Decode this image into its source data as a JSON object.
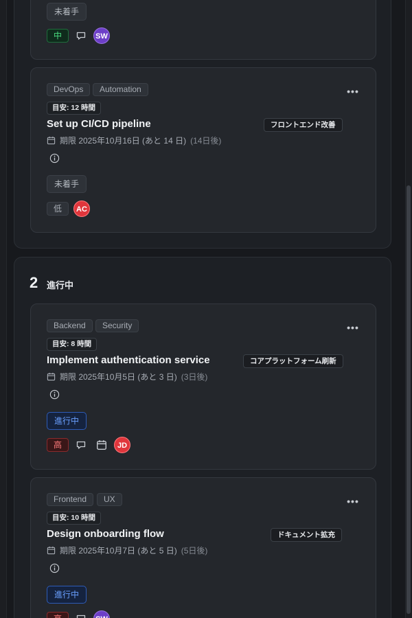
{
  "top_card": {
    "status": "未着手",
    "priority": "中",
    "assignee": "SW"
  },
  "card_cicd": {
    "tags": [
      "DevOps",
      "Automation"
    ],
    "estimate": "目安: 12 時間",
    "title": "Set up CI/CD pipeline",
    "project": "フロントエンド改善",
    "due_text": "期限 2025年10月16日 (あと 14 日)",
    "due_rel": "(14日後)",
    "status": "未着手",
    "priority": "低",
    "assignee": "AC"
  },
  "group_in_progress": {
    "count": "2",
    "label": "進行中"
  },
  "card_auth": {
    "tags": [
      "Backend",
      "Security"
    ],
    "estimate": "目安: 8 時間",
    "title": "Implement authentication service",
    "project": "コアプラットフォーム刷新",
    "due_text": "期限 2025年10月5日 (あと 3 日)",
    "due_rel": "(3日後)",
    "status": "進行中",
    "priority": "高",
    "assignee": "JD"
  },
  "card_onboarding": {
    "tags": [
      "Frontend",
      "UX"
    ],
    "estimate": "目安: 10 時間",
    "title": "Design onboarding flow",
    "project": "ドキュメント拡充",
    "due_text": "期限 2025年10月7日 (あと 5 日)",
    "due_rel": "(5日後)",
    "status": "進行中",
    "priority": "高",
    "assignee": "SW"
  },
  "icons": {
    "comment": "comment-icon",
    "calendar": "calendar-icon",
    "info": "info-icon",
    "menu": "more-horizontal-icon"
  },
  "colors": {
    "background": "#17191d",
    "card": "#24272c",
    "in_progress": "#6aa0ff",
    "priority_high": "#ff7b7b",
    "priority_mid": "#4ade80"
  }
}
